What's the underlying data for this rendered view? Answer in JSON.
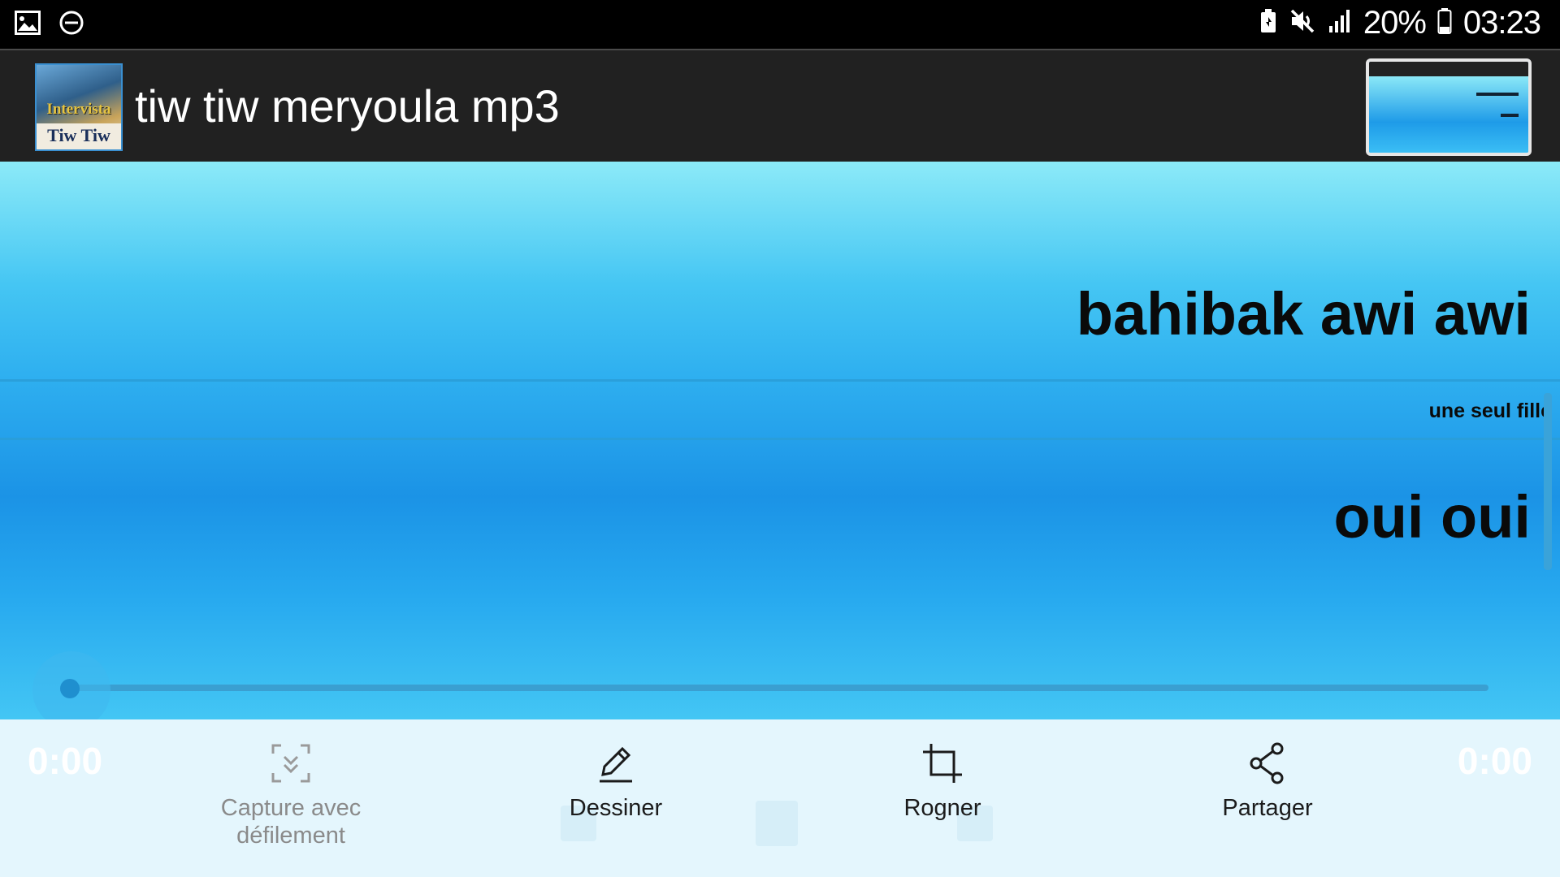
{
  "status_bar": {
    "battery_percent": "20%",
    "time": "03:23",
    "icons": [
      "gallery-icon",
      "dnd-icon",
      "battery-saver-icon",
      "mute-icon",
      "signal-icon",
      "battery-icon"
    ]
  },
  "app_bar": {
    "title": "tiw tiw meryoula mp3",
    "icon_label_top": "Intervista",
    "icon_label_bottom": "Tiw Tiw"
  },
  "lyrics": {
    "line_1": "bahibak awi awi",
    "line_2": "une seul fille",
    "line_3": "oui oui"
  },
  "player": {
    "time_elapsed": "0:00",
    "time_total": "0:00",
    "progress": 0
  },
  "screenshot_toolbar": {
    "capture_line1": "Capture avec",
    "capture_line2": "défilement",
    "draw": "Dessiner",
    "crop": "Rogner",
    "share": "Partager"
  },
  "colors": {
    "status_bg": "#000000",
    "appbar_bg": "#212121",
    "gradient_top": "#8ceaf8",
    "gradient_mid": "#1b93e6",
    "toolbar_bg": "#e4f6fd"
  }
}
